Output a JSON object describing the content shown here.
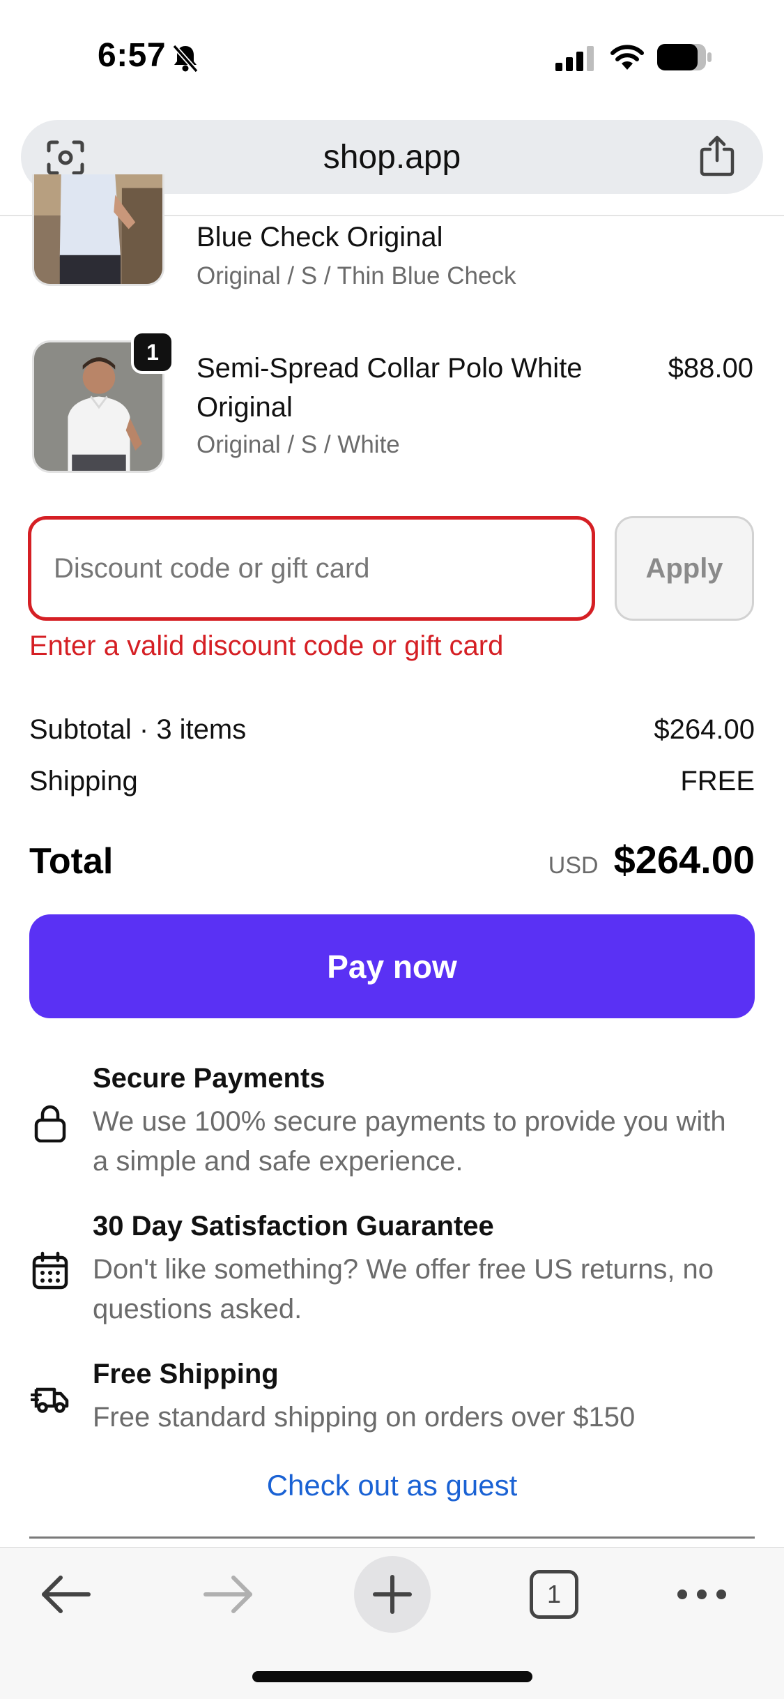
{
  "status_bar": {
    "time": "6:57",
    "icons": [
      "bell-slash-icon",
      "cellular-signal-icon",
      "wifi-icon",
      "battery-icon"
    ]
  },
  "browser": {
    "url": "shop.app",
    "left_icon": "lens-icon",
    "right_icon": "share-icon"
  },
  "cart": {
    "items": [
      {
        "title": "Blue Check Original",
        "variant": "Original / S / Thin Blue Check",
        "price": ""
      },
      {
        "title": "Semi-Spread Collar Polo White Original",
        "variant": "Original / S / White",
        "price": "$88.00",
        "quantity": "1"
      }
    ]
  },
  "discount": {
    "placeholder": "Discount code or gift card",
    "value": "",
    "apply_label": "Apply",
    "error": "Enter a valid discount code or gift card"
  },
  "summary": {
    "subtotal_label": "Subtotal · 3 items",
    "subtotal_value": "$264.00",
    "shipping_label": "Shipping",
    "shipping_value": "FREE",
    "total_label": "Total",
    "currency": "USD",
    "total_value": "$264.00"
  },
  "pay_button_label": "Pay now",
  "features": [
    {
      "icon": "lock-icon",
      "title": "Secure Payments",
      "description": "We use 100% secure payments to provide you with a simple and safe experience."
    },
    {
      "icon": "calendar-icon",
      "title": "30 Day Satisfaction Guarantee",
      "description": "Don't like something? We offer free US returns, no questions asked."
    },
    {
      "icon": "delivery-truck-icon",
      "title": "Free Shipping",
      "description": "Free standard shipping on orders over $150"
    }
  ],
  "guest_checkout_label": "Check out as guest",
  "toolbar": {
    "tab_count": "1",
    "icons": [
      "back-arrow-icon",
      "forward-arrow-icon",
      "plus-icon",
      "tabs-icon",
      "more-icon"
    ]
  },
  "colors": {
    "pay_button": "#5a31f4",
    "error": "#d51f24",
    "link": "#1a62d4"
  }
}
